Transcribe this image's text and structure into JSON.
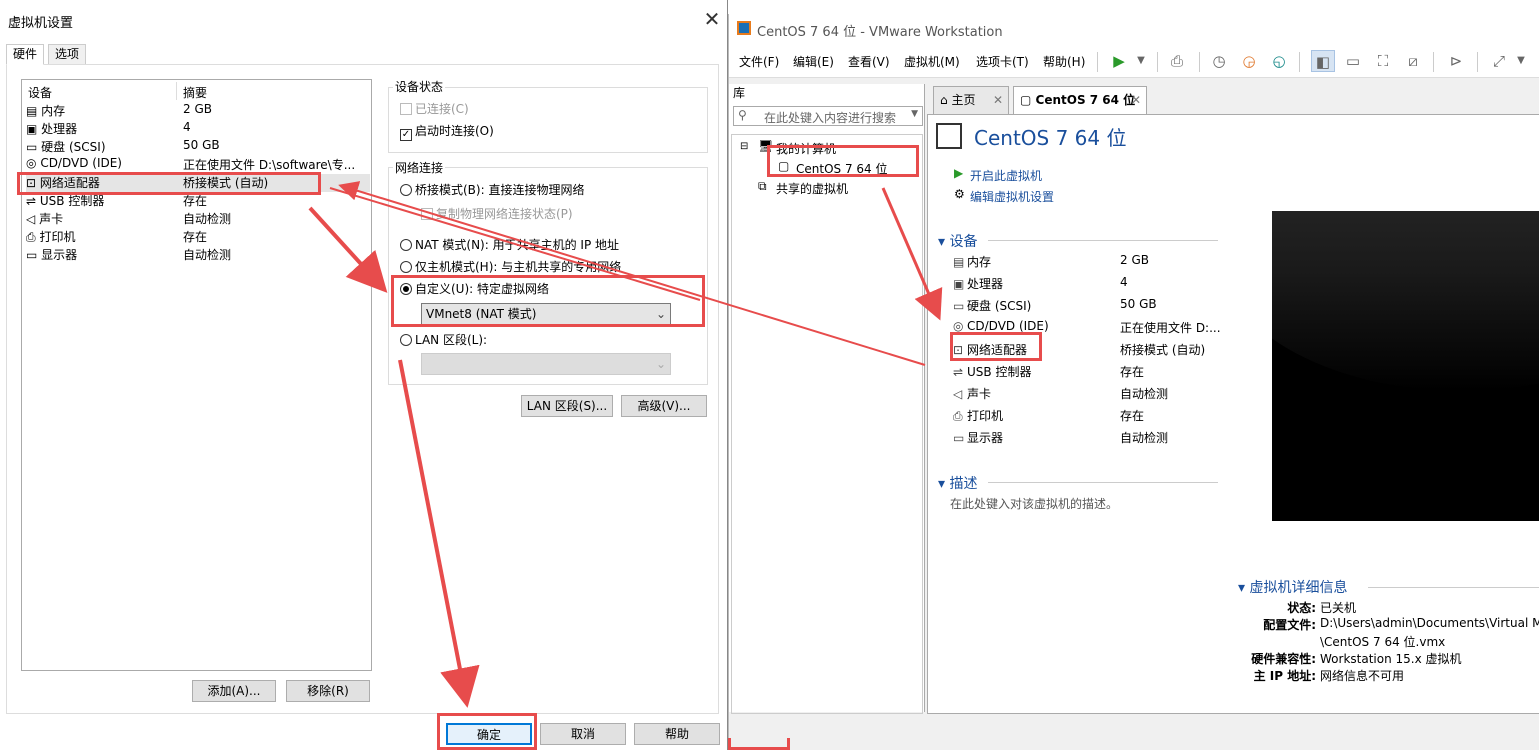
{
  "vmware": {
    "title": "CentOS 7 64 位 - VMware Workstation",
    "menu": [
      "文件(F)",
      "编辑(E)",
      "查看(V)",
      "虚拟机(M)",
      "选项卡(T)",
      "帮助(H)"
    ],
    "library": {
      "title": "库",
      "search_placeholder": "在此处键入内容进行搜索",
      "tree": {
        "root": "我的计算机",
        "vm": "CentOS 7 64 位",
        "shared": "共享的虚拟机"
      }
    },
    "tabs": [
      "主页",
      "CentOS 7 64 位"
    ],
    "vm_title": "CentOS 7 64 位",
    "actions": {
      "power_on": "开启此虚拟机",
      "edit": "编辑虚拟机设置"
    },
    "devices_header": "设备",
    "devices": [
      {
        "name": "内存",
        "value": "2 GB",
        "icon": "memory-icon"
      },
      {
        "name": "处理器",
        "value": "4",
        "icon": "cpu-icon"
      },
      {
        "name": "硬盘 (SCSI)",
        "value": "50 GB",
        "icon": "disk-icon"
      },
      {
        "name": "CD/DVD (IDE)",
        "value": "正在使用文件 D:...",
        "icon": "cd-icon"
      },
      {
        "name": "网络适配器",
        "value": "桥接模式 (自动)",
        "icon": "network-icon"
      },
      {
        "name": "USB 控制器",
        "value": "存在",
        "icon": "usb-icon"
      },
      {
        "name": "声卡",
        "value": "自动检测",
        "icon": "sound-icon"
      },
      {
        "name": "打印机",
        "value": "存在",
        "icon": "printer-icon"
      },
      {
        "name": "显示器",
        "value": "自动检测",
        "icon": "monitor-icon"
      }
    ],
    "description_header": "描述",
    "description_placeholder": "在此处键入对该虚拟机的描述。",
    "details_header": "虚拟机详细信息",
    "details": [
      {
        "key": "状态:",
        "value": "已关机"
      },
      {
        "key": "配置文件:",
        "value": "D:\\Users\\admin\\Documents\\Virtual M"
      },
      {
        "key": "",
        "value": "\\CentOS 7 64 位.vmx"
      },
      {
        "key": "硬件兼容性:",
        "value": "Workstation 15.x 虚拟机"
      },
      {
        "key": "主 IP 地址:",
        "value": "网络信息不可用"
      }
    ]
  },
  "dialog": {
    "title": "虚拟机设置",
    "tabs": [
      "硬件",
      "选项"
    ],
    "columns": [
      "设备",
      "摘要"
    ],
    "devices": [
      {
        "name": "内存",
        "summary": "2 GB",
        "icon": "memory-icon"
      },
      {
        "name": "处理器",
        "summary": "4",
        "icon": "cpu-icon"
      },
      {
        "name": "硬盘 (SCSI)",
        "summary": "50 GB",
        "icon": "disk-icon"
      },
      {
        "name": "CD/DVD (IDE)",
        "summary": "正在使用文件 D:\\software\\专...",
        "icon": "cd-icon"
      },
      {
        "name": "网络适配器",
        "summary": "桥接模式 (自动)",
        "icon": "network-icon"
      },
      {
        "name": "USB 控制器",
        "summary": "存在",
        "icon": "usb-icon"
      },
      {
        "name": "声卡",
        "summary": "自动检测",
        "icon": "sound-icon"
      },
      {
        "name": "打印机",
        "summary": "存在",
        "icon": "printer-icon"
      },
      {
        "name": "显示器",
        "summary": "自动检测",
        "icon": "monitor-icon"
      }
    ],
    "add_button": "添加(A)...",
    "remove_button": "移除(R)",
    "device_status": {
      "header": "设备状态",
      "connected": "已连接(C)",
      "connect_on_start": "启动时连接(O)"
    },
    "network": {
      "header": "网络连接",
      "bridged": "桥接模式(B): 直接连接物理网络",
      "replicate": "复制物理网络连接状态(P)",
      "nat": "NAT 模式(N): 用于共享主机的 IP 地址",
      "host_only": "仅主机模式(H): 与主机共享的专用网络",
      "custom": "自定义(U): 特定虚拟网络",
      "custom_value": "VMnet8 (NAT 模式)",
      "lan": "LAN 区段(L):",
      "lan_value": ""
    },
    "lan_button": "LAN 区段(S)...",
    "advanced_button": "高级(V)...",
    "ok": "确定",
    "cancel": "取消",
    "help": "帮助"
  },
  "colors": {
    "annotation": "#e74c4c",
    "accent": "#1a4f9c"
  }
}
